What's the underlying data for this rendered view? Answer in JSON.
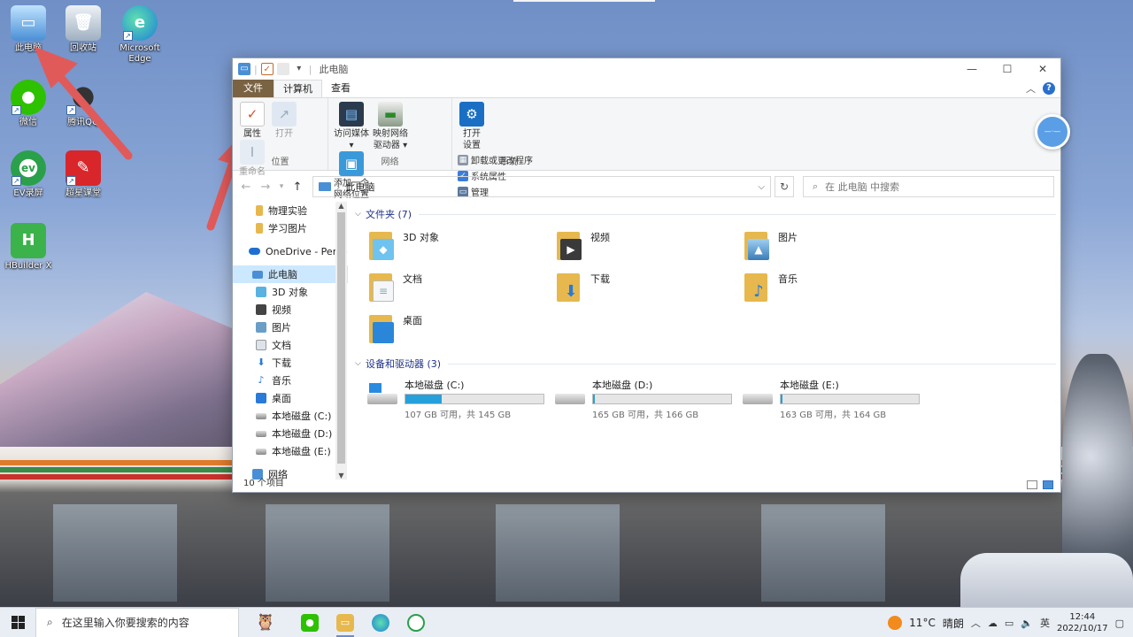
{
  "desktop": {
    "icons": [
      {
        "label": "此电脑",
        "icon": "computer-icon"
      },
      {
        "label": "回收站",
        "icon": "recycle-bin-icon"
      },
      {
        "label": "Microsoft Edge",
        "icon": "edge-icon"
      },
      {
        "label": "微信",
        "icon": "wechat-icon"
      },
      {
        "label": "腾讯QQ",
        "icon": "qq-icon"
      },
      {
        "label": "EV录屏",
        "icon": "ev-recorder-icon"
      },
      {
        "label": "超星课堂",
        "icon": "chaoxing-icon"
      },
      {
        "label": "HBuilder X",
        "icon": "hbuilder-icon"
      }
    ],
    "edge_letter": "e",
    "hbuilder_letter": "H",
    "arrow_color": "#e05a5a"
  },
  "window": {
    "title": "此电脑",
    "controls": {
      "minimize": "—",
      "maximize": "☐",
      "close": "✕"
    }
  },
  "ribbon": {
    "tabs": [
      {
        "label": "文件"
      },
      {
        "label": "计算机",
        "active": true
      },
      {
        "label": "查看"
      }
    ],
    "groups": {
      "location": {
        "label": "位置",
        "buttons": [
          {
            "label": "属性",
            "enabled": true
          },
          {
            "label": "打开",
            "enabled": false
          },
          {
            "label": "重命名",
            "enabled": false
          }
        ]
      },
      "network": {
        "label": "网络",
        "buttons": [
          {
            "line1": "访问媒体",
            "line2": "▾"
          },
          {
            "line1": "映射网络",
            "line2": "驱动器 ▾"
          },
          {
            "line1": "添加一个",
            "line2": "网络位置"
          }
        ]
      },
      "system": {
        "label": "系统",
        "open_settings": {
          "line1": "打开",
          "line2": "设置"
        },
        "small_items": [
          "卸载或更改程序",
          "系统属性",
          "管理"
        ]
      }
    }
  },
  "address": {
    "path": "此电脑",
    "search_placeholder": "在 此电脑 中搜索"
  },
  "nav_pane": {
    "items": [
      {
        "label": "物理实验",
        "icon": "folder-icon"
      },
      {
        "label": "学习图片",
        "icon": "folder-icon"
      },
      {
        "label": "OneDrive - Perso",
        "icon": "onedrive-icon"
      },
      {
        "label": "此电脑",
        "icon": "computer-icon",
        "selected": true
      },
      {
        "label": "3D 对象",
        "icon": "3d-objects-icon"
      },
      {
        "label": "视频",
        "icon": "video-icon"
      },
      {
        "label": "图片",
        "icon": "pictures-icon"
      },
      {
        "label": "文档",
        "icon": "documents-icon"
      },
      {
        "label": "下载",
        "icon": "downloads-icon"
      },
      {
        "label": "音乐",
        "icon": "music-icon"
      },
      {
        "label": "桌面",
        "icon": "desktop-icon"
      },
      {
        "label": "本地磁盘 (C:)",
        "icon": "drive-icon"
      },
      {
        "label": "本地磁盘 (D:)",
        "icon": "drive-icon"
      },
      {
        "label": "本地磁盘 (E:)",
        "icon": "drive-icon"
      },
      {
        "label": "网络",
        "icon": "network-icon"
      }
    ]
  },
  "content": {
    "folders_header": "文件夹 (7)",
    "folders": [
      {
        "label": "3D 对象",
        "icon": "3d-objects-icon"
      },
      {
        "label": "视频",
        "icon": "video-icon"
      },
      {
        "label": "图片",
        "icon": "pictures-icon"
      },
      {
        "label": "文档",
        "icon": "documents-icon"
      },
      {
        "label": "下载",
        "icon": "downloads-icon"
      },
      {
        "label": "音乐",
        "icon": "music-icon"
      },
      {
        "label": "桌面",
        "icon": "desktop-icon"
      }
    ],
    "drives_header": "设备和驱动器 (3)",
    "drives": [
      {
        "label": "本地磁盘 (C:)",
        "detail": "107 GB 可用，共 145 GB",
        "used_fraction": 0.26,
        "system": true
      },
      {
        "label": "本地磁盘 (D:)",
        "detail": "165 GB 可用，共 166 GB",
        "used_fraction": 0.01,
        "system": false
      },
      {
        "label": "本地磁盘 (E:)",
        "detail": "163 GB 可用，共 164 GB",
        "used_fraction": 0.01,
        "system": false
      }
    ]
  },
  "status": {
    "item_count": "10 个项目"
  },
  "taskbar": {
    "search_placeholder": "在这里输入你要搜索的内容",
    "temperature": "11°C",
    "weather": "晴朗",
    "ime": "英",
    "time": "12:44",
    "date": "2022/10/17"
  }
}
